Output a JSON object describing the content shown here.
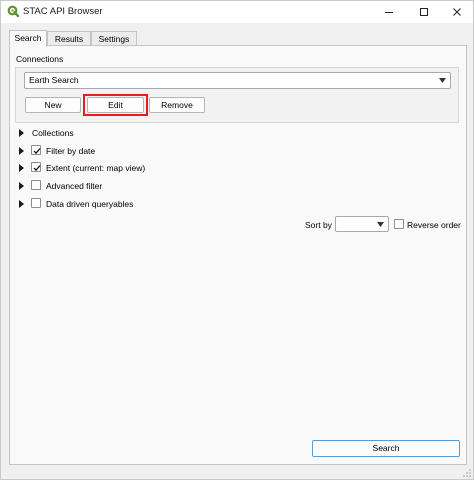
{
  "window": {
    "title": "STAC API Browser",
    "accent_color": "#5b9bd5",
    "icons": [
      "qgis-logo-icon",
      "minimize-icon",
      "maximize-icon",
      "close-icon"
    ]
  },
  "tabs": [
    {
      "label": "Search",
      "active": true
    },
    {
      "label": "Results",
      "active": false
    },
    {
      "label": "Settings",
      "active": false
    }
  ],
  "connections": {
    "label": "Connections",
    "selected": "Earth Search",
    "buttons": {
      "new": "New",
      "edit": "Edit",
      "remove": "Remove"
    },
    "highlight_color": "#e02020"
  },
  "filters": [
    {
      "label": "Collections",
      "has_checkbox": false,
      "checked": false
    },
    {
      "label": "Filter by date",
      "has_checkbox": true,
      "checked": true
    },
    {
      "label": "Extent (current: map view)",
      "has_checkbox": true,
      "checked": true
    },
    {
      "label": "Advanced filter",
      "has_checkbox": true,
      "checked": false
    },
    {
      "label": "Data driven queryables",
      "has_checkbox": true,
      "checked": false
    }
  ],
  "sort": {
    "label": "Sort by",
    "value": "",
    "reverse_label": "Reverse order",
    "reverse_checked": false
  },
  "search_button": "Search"
}
